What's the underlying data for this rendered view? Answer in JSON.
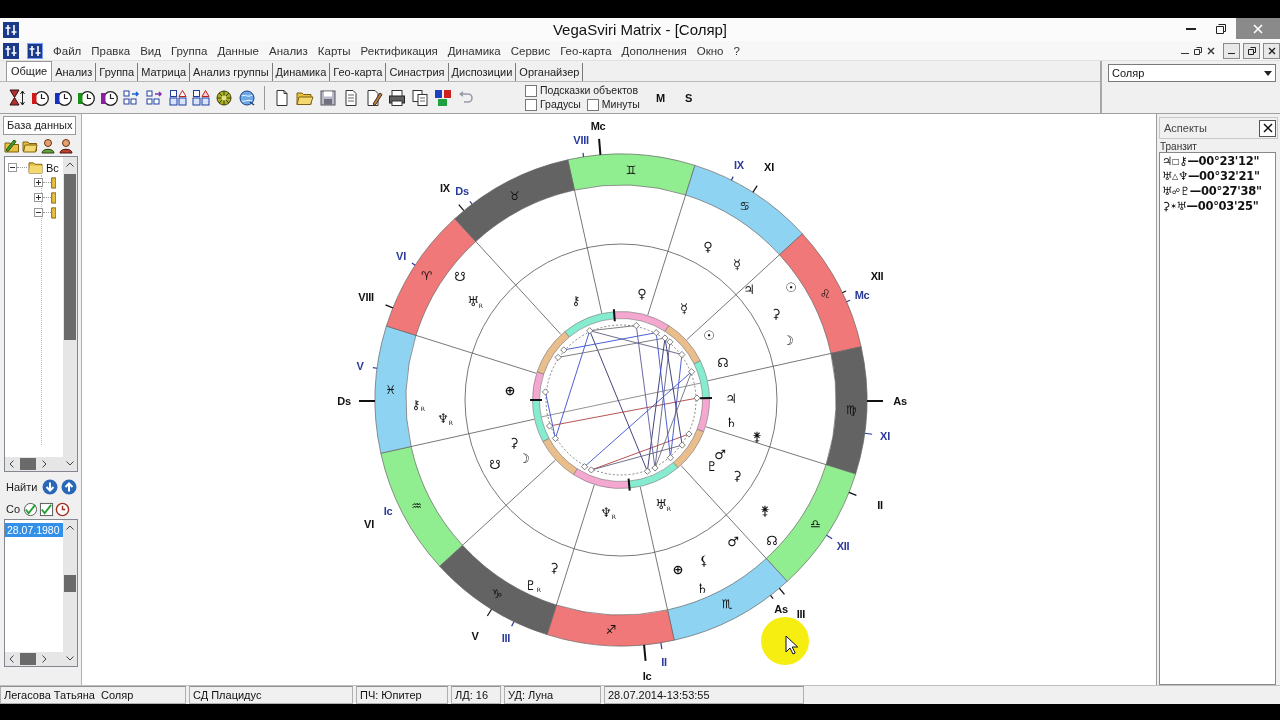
{
  "window": {
    "title": "VegaSviri Matrix - [Соляр]"
  },
  "menu": [
    "Файл",
    "Правка",
    "Вид",
    "Группа",
    "Данные",
    "Анализ",
    "Карты",
    "Ректификация",
    "Динамика",
    "Сервис",
    "Гео-карта",
    "Дополнения",
    "Окно",
    "?"
  ],
  "tabs": [
    {
      "label": "Общие",
      "selected": true
    },
    {
      "label": "Анализ",
      "selected": false
    },
    {
      "label": "Группа",
      "selected": false
    },
    {
      "label": "Матрица",
      "selected": false
    },
    {
      "label": "Анализ группы",
      "selected": false
    },
    {
      "label": "Динамика",
      "selected": false
    },
    {
      "label": "Гео-карта",
      "selected": false
    },
    {
      "label": "Синастрия",
      "selected": false
    },
    {
      "label": "Диспозиции",
      "selected": false
    },
    {
      "label": "Органайзер",
      "selected": false
    }
  ],
  "toolbar": {
    "options": [
      {
        "label": "Подсказки объектов",
        "checked": false
      },
      {
        "label": "Градусы",
        "checked": false
      },
      {
        "label": "Минуты",
        "checked": false
      }
    ],
    "buttons": [
      "M",
      "S"
    ]
  },
  "chart_selector": {
    "value": "Соляр"
  },
  "database_panel": {
    "tab": "База данных",
    "tree": [
      {
        "label": "Вс",
        "expanded": true,
        "children": [
          {
            "expanded": false
          },
          {
            "expanded": false
          },
          {
            "expanded": true
          }
        ]
      }
    ],
    "find_label": "Найти",
    "events_label": "Со",
    "events": [
      {
        "label": "28.07.1980",
        "selected": true
      }
    ]
  },
  "chart": {
    "signs": [
      {
        "glyph": "♊",
        "color": "#90ee90"
      },
      {
        "glyph": "♋",
        "color": "#8fd3f2"
      },
      {
        "glyph": "♌",
        "color": "#f07878"
      },
      {
        "glyph": "♍",
        "color": "#636363"
      },
      {
        "glyph": "♎",
        "color": "#90ee90"
      },
      {
        "glyph": "♏",
        "color": "#8fd3f2"
      },
      {
        "glyph": "♐",
        "color": "#f07878"
      },
      {
        "glyph": "♑",
        "color": "#636363"
      },
      {
        "glyph": "♒",
        "color": "#90ee90"
      },
      {
        "glyph": "♓",
        "color": "#8fd3f2"
      },
      {
        "glyph": "♈",
        "color": "#f07878"
      },
      {
        "glyph": "♉",
        "color": "#636363"
      }
    ],
    "cusp_labels": [
      {
        "text": "Mc",
        "kind": "primary"
      },
      {
        "text": "VIII",
        "kind": "secondary"
      },
      {
        "text": "IX",
        "kind": "secondary"
      },
      {
        "text": "XI",
        "kind": "primary"
      },
      {
        "text": "XII",
        "kind": "primary"
      },
      {
        "text": "Mc",
        "kind": "secondary"
      },
      {
        "text": "As",
        "kind": "primary"
      },
      {
        "text": "XI",
        "kind": "secondary"
      },
      {
        "text": "II",
        "kind": "primary"
      },
      {
        "text": "XII",
        "kind": "secondary"
      },
      {
        "text": "As",
        "kind": "primary"
      },
      {
        "text": "III",
        "kind": "primary"
      },
      {
        "text": "II",
        "kind": "secondary"
      },
      {
        "text": "Ic",
        "kind": "primary"
      },
      {
        "text": "III",
        "kind": "secondary"
      },
      {
        "text": "V",
        "kind": "primary"
      },
      {
        "text": "VI",
        "kind": "primary"
      },
      {
        "text": "Ic",
        "kind": "secondary"
      },
      {
        "text": "Ds",
        "kind": "primary"
      },
      {
        "text": "V",
        "kind": "secondary"
      },
      {
        "text": "VIII",
        "kind": "primary"
      },
      {
        "text": "VI",
        "kind": "secondary"
      },
      {
        "text": "IX",
        "kind": "primary"
      },
      {
        "text": "Ds",
        "kind": "secondary"
      }
    ],
    "transit_planets": [
      "♀",
      "☿",
      "♃",
      "☉",
      "⚳",
      "☽",
      "⚵",
      "☊",
      "♂",
      "⚸",
      "⊕",
      "♄",
      "⚳",
      "♇$_{R}$",
      "⚷$_{R}$",
      "♆$_{R}$",
      "☋",
      "♅$_{R}$"
    ],
    "natal_planets": [
      "⚷",
      "♀",
      "☿",
      "☉",
      "☊",
      "♃",
      "♄",
      "⚵",
      "♂",
      "♇",
      "⚳",
      "♅$_{R}$",
      "♆$_{R}$",
      "☋",
      "☽",
      "⚳",
      "⊕"
    ]
  },
  "aspects_panel": {
    "title": "Аспекты",
    "section": "Транзит",
    "rows": [
      {
        "planet_1": "♃",
        "aspect": "□",
        "planet_2": "⚷",
        "orb": "—00°23'12\""
      },
      {
        "planet_1": "♅",
        "aspect": "△",
        "planet_2": "♆",
        "orb": "—00°32'21\""
      },
      {
        "planet_1": "♅",
        "aspect": "☍",
        "planet_2": "♇",
        "orb": "—00°27'38\""
      },
      {
        "planet_1": "⚳",
        "aspect": "✶",
        "planet_2": "♅",
        "orb": "—00°03'25\""
      }
    ]
  },
  "status_bar": [
    "Легасова Татьяна  Соляр",
    "СД Плацидус",
    "ПЧ: Юпитер",
    "ЛД: 16",
    "УД: Луна",
    "28.07.2014-13:53:55"
  ]
}
